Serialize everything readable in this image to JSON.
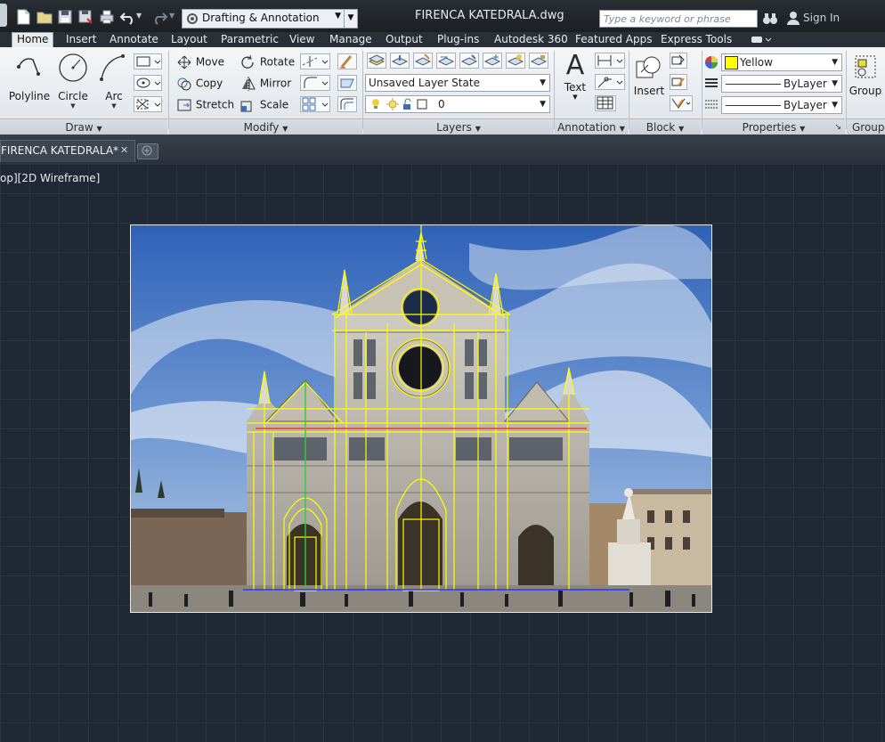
{
  "title_bar": {
    "workspace": "Drafting & Annotation",
    "document_title": "FIRENCA KATEDRALA.dwg",
    "search_placeholder": "Type a keyword or phrase",
    "sign_in": "Sign In"
  },
  "ribbon_tabs": [
    "Home",
    "Insert",
    "Annotate",
    "Layout",
    "Parametric",
    "View",
    "Manage",
    "Output",
    "Plug-ins",
    "Autodesk 360",
    "Featured Apps",
    "Express Tools"
  ],
  "active_tab": "Home",
  "draw_panel": {
    "title": "Draw",
    "polyline": "Polyline",
    "circle": "Circle",
    "arc": "Arc"
  },
  "modify_panel": {
    "title": "Modify",
    "move": "Move",
    "rotate": "Rotate",
    "copy": "Copy",
    "mirror": "Mirror",
    "stretch": "Stretch",
    "scale": "Scale"
  },
  "layers_panel": {
    "title": "Layers",
    "layer_state": "Unsaved Layer State",
    "current_layer": "0"
  },
  "annotation_panel": {
    "title": "Annotation",
    "text": "Text"
  },
  "block_panel": {
    "title": "Block",
    "insert": "Insert"
  },
  "properties_panel": {
    "title": "Properties",
    "color": "Yellow",
    "color_hex": "#ffff00",
    "linetype": "ByLayer",
    "lineweight": "ByLayer"
  },
  "groups_panel": {
    "title": "Groups",
    "group": "Group"
  },
  "file_tab": {
    "name": "FIRENCA KATEDRALA*",
    "close": "✕"
  },
  "viewport": {
    "label": "op][2D Wireframe]"
  },
  "colors": {
    "accent_layer": "#ffff00",
    "overlay_red": "#ff3030",
    "overlay_green": "#2fd12f",
    "overlay_blue": "#3030ff"
  }
}
